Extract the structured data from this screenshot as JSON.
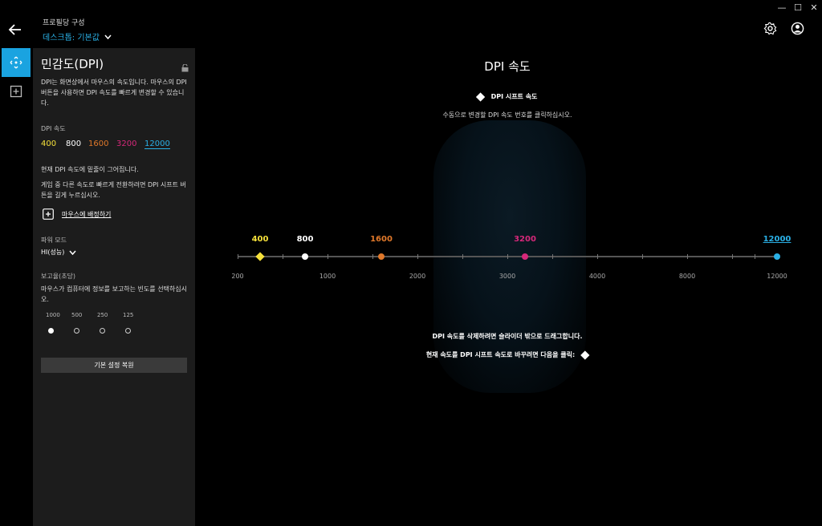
{
  "header": {
    "subtitle": "프로필당 구성",
    "profile": "데스크톱: 기본값"
  },
  "window": {
    "minimize": "—",
    "maximize": "☐",
    "close": "✕"
  },
  "panel": {
    "title": "민감도(DPI)",
    "description": "DPI는 화면상에서 마우스의 속도입니다. 마우스의 DPI 버튼을 사용하면 DPI 속도를 빠르게 변경할 수 있습니다.",
    "dpi_label": "DPI 속도",
    "speeds": [
      {
        "value": "400",
        "color": "#f5e03a"
      },
      {
        "value": "800",
        "color": "#ffffff"
      },
      {
        "value": "1600",
        "color": "#e0782a"
      },
      {
        "value": "3200",
        "color": "#d6287a"
      },
      {
        "value": "12000",
        "color": "#2ab0e6"
      }
    ],
    "info1": "현재 DPI 속도에 밑줄이 그어집니다.",
    "info2": "게임 중 다른 속도로 빠르게 전환하려면 DPI 시프트 버튼을 길게 누르십시오.",
    "assign_label": "마우스에 배정하기",
    "power_label": "파워 모드",
    "power_value": "HI(성능)",
    "report_label": "보고율(초당)",
    "report_desc": "마우스가 컴퓨터에 정보를 보고하는 빈도를 선택하십시오.",
    "report_rates": [
      "1000",
      "500",
      "250",
      "125"
    ],
    "report_selected": "1000",
    "reset_button": "기본 설정 복원"
  },
  "main": {
    "title": "DPI 속도",
    "shift_label": "DPI 시프트 속도",
    "instruction": "수동으로 변경할 DPI 속도 번호를 클릭하십시오.",
    "delete_hint": "DPI 속도를 삭제하려면 슬라이더 밖으로 드래그합니다.",
    "shift_hint": "현재 속도를 DPI 시프트 속도로 바꾸려면 다음을 클릭:"
  },
  "chart_data": {
    "type": "scatter",
    "axis_ticks": [
      "200",
      "1000",
      "2000",
      "3000",
      "4000",
      "8000",
      "12000"
    ],
    "points": [
      {
        "label": "400",
        "color": "#f5e03a",
        "shape": "diamond"
      },
      {
        "label": "800",
        "color": "#ffffff",
        "shape": "dot"
      },
      {
        "label": "1600",
        "color": "#e0782a",
        "shape": "dot"
      },
      {
        "label": "3200",
        "color": "#d6287a",
        "shape": "dot"
      },
      {
        "label": "12000",
        "color": "#2ab0e6",
        "shape": "dot",
        "current": true
      }
    ]
  }
}
